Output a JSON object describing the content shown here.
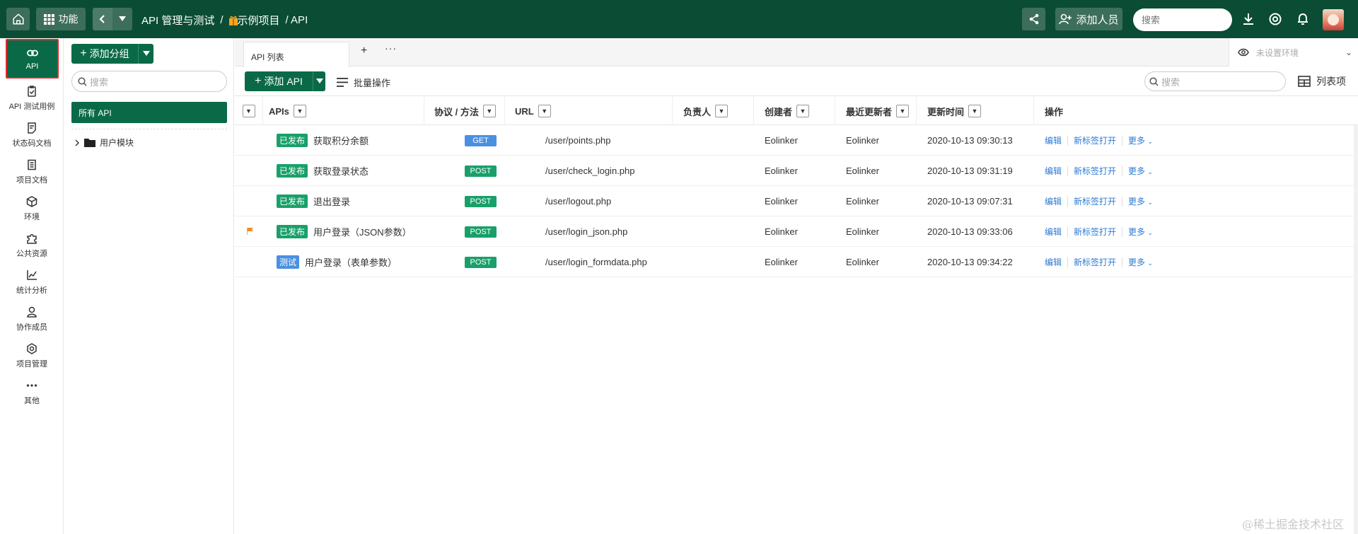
{
  "topbar": {
    "func_label": "功能",
    "breadcrumb": [
      "API 管理与测试",
      "/",
      "示例项目",
      "/ API"
    ],
    "add_member_label": "添加人员",
    "search_placeholder": "搜索"
  },
  "leftnav": [
    {
      "label": "API",
      "icon": "link-icon",
      "active": true
    },
    {
      "label": "API 测试用例",
      "icon": "clipboard-check-icon"
    },
    {
      "label": "状态码文档",
      "icon": "doc-icon"
    },
    {
      "label": "项目文档",
      "icon": "book-icon"
    },
    {
      "label": "环境",
      "icon": "cube-icon"
    },
    {
      "label": "公共资源",
      "icon": "puzzle-icon"
    },
    {
      "label": "统计分析",
      "icon": "chart-icon"
    },
    {
      "label": "协作成员",
      "icon": "user-icon"
    },
    {
      "label": "项目管理",
      "icon": "gear-icon"
    },
    {
      "label": "其他",
      "icon": "more-icon"
    }
  ],
  "group_panel": {
    "add_group_label": "添加分组",
    "search_placeholder": "搜索",
    "all_api_label": "所有 API",
    "module_label": "用户模块"
  },
  "tabs": {
    "api_list_tab": "API 列表",
    "env_placeholder": "未设置环境"
  },
  "toolbar": {
    "add_api_label": "添加 API",
    "batch_label": "批量操作",
    "search_placeholder": "搜索",
    "columns_label": "列表项"
  },
  "table": {
    "headers": {
      "apis": "APIs",
      "protocol": "协议 / 方法",
      "url": "URL",
      "owner": "负责人",
      "creator": "创建者",
      "updater": "最近更新者",
      "updated_time": "更新时间",
      "actions": "操作"
    },
    "rows": [
      {
        "status": "已发布",
        "status_color": "#19a06a",
        "name": "获取积分余额",
        "method": "GET",
        "method_color": "#4a90e2",
        "url": "/user/points.php",
        "owner": "",
        "creator": "Eolinker",
        "updater": "Eolinker",
        "time": "2020-10-13 09:30:13",
        "flag": false
      },
      {
        "status": "已发布",
        "status_color": "#19a06a",
        "name": "获取登录状态",
        "method": "POST",
        "method_color": "#19a06a",
        "url": "/user/check_login.php",
        "owner": "",
        "creator": "Eolinker",
        "updater": "Eolinker",
        "time": "2020-10-13 09:31:19",
        "flag": false
      },
      {
        "status": "已发布",
        "status_color": "#19a06a",
        "name": "退出登录",
        "method": "POST",
        "method_color": "#19a06a",
        "url": "/user/logout.php",
        "owner": "",
        "creator": "Eolinker",
        "updater": "Eolinker",
        "time": "2020-10-13 09:07:31",
        "flag": false
      },
      {
        "status": "已发布",
        "status_color": "#19a06a",
        "name": "用户登录（JSON参数）",
        "method": "POST",
        "method_color": "#19a06a",
        "url": "/user/login_json.php",
        "owner": "",
        "creator": "Eolinker",
        "updater": "Eolinker",
        "time": "2020-10-13 09:33:06",
        "flag": true
      },
      {
        "status": "测试",
        "status_color": "#4a90e2",
        "name": "用户登录（表单参数）",
        "method": "POST",
        "method_color": "#19a06a",
        "url": "/user/login_formdata.php",
        "owner": "",
        "creator": "Eolinker",
        "updater": "Eolinker",
        "time": "2020-10-13 09:34:22",
        "flag": false
      }
    ],
    "actions": {
      "edit": "编辑",
      "open_tab": "新标签打开",
      "more": "更多"
    }
  },
  "watermark": "@稀土掘金技术社区",
  "colors": {
    "brand": "#0a4d34",
    "accent": "#0a6a48",
    "link": "#2d7bd1",
    "highlight_border": "#e12b2b"
  }
}
